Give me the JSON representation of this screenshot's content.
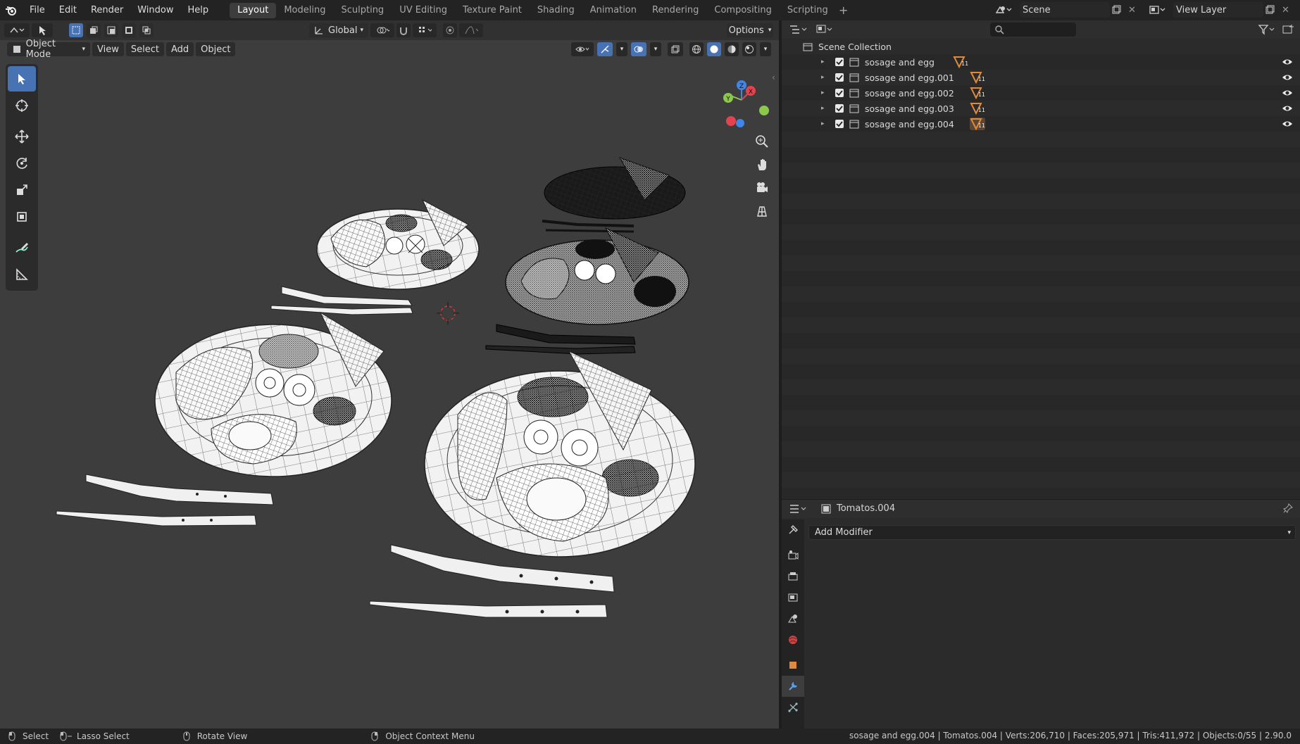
{
  "menu": [
    "File",
    "Edit",
    "Render",
    "Window",
    "Help"
  ],
  "workspace_tabs": [
    "Layout",
    "Modeling",
    "Sculpting",
    "UV Editing",
    "Texture Paint",
    "Shading",
    "Animation",
    "Rendering",
    "Compositing",
    "Scripting"
  ],
  "active_workspace": "Layout",
  "scene_name": "Scene",
  "view_layer": "View Layer",
  "viewport": {
    "orientation": "Global",
    "options_label": "Options",
    "mode": "Object Mode",
    "menus": [
      "View",
      "Select",
      "Add",
      "Object"
    ],
    "gizmo_axes": {
      "x": "X",
      "y": "Y",
      "z": "Z"
    }
  },
  "outliner": {
    "root": "Scene Collection",
    "collections": [
      {
        "name": "sosage and egg",
        "icon_sub": "11"
      },
      {
        "name": "sosage and egg.001",
        "icon_sub": "11"
      },
      {
        "name": "sosage and egg.002",
        "icon_sub": "11"
      },
      {
        "name": "sosage and egg.003",
        "icon_sub": "11"
      },
      {
        "name": "sosage and egg.004",
        "icon_sub": "11"
      }
    ]
  },
  "properties": {
    "object_name": "Tomatos.004",
    "add_modifier_label": "Add Modifier",
    "tabs": [
      "tool",
      "render",
      "output",
      "view-layer",
      "scene",
      "world",
      "object",
      "modifiers",
      "particles"
    ],
    "active_tab": "modifiers"
  },
  "statusbar": {
    "select": "Select",
    "lasso": "Lasso Select",
    "rotate": "Rotate View",
    "context": "Object Context Menu",
    "stats": "sosage and egg.004 | Tomatos.004 | Verts:206,710 | Faces:205,971 | Tris:411,972 | Objects:0/55 | 2.90.0"
  },
  "colors": {
    "accent": "#4772b3",
    "collection_icon": "#e08a3c",
    "axis_x": "#e5414f",
    "axis_y": "#8cc84b",
    "axis_z": "#3f86e8"
  }
}
